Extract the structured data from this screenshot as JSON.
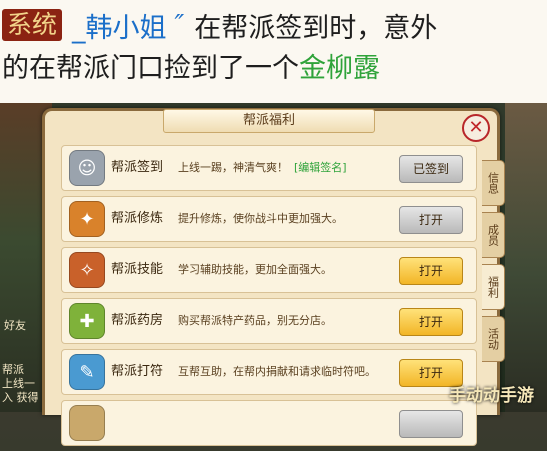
{
  "chat": {
    "tag": "系统",
    "sender": "_韩小姐",
    "bubble": "″",
    "message_part1": "在帮派签到时，意外",
    "message_part2": "的在帮派门口捡到了一个",
    "item": "金柳露"
  },
  "scene": {
    "left_text_1": "好友",
    "left_text_2": "帮派",
    "left_text_3": "上线一",
    "left_text_4": "入 获得"
  },
  "window": {
    "title": "帮派福利",
    "close_label": "✕"
  },
  "rows": [
    {
      "name": "帮派签到",
      "desc": "上线一踢，神清气爽！",
      "link": "[编辑签名]",
      "button": "已签到",
      "button_style": "gray",
      "icon": "sign-in-icon",
      "color": "#9aa3ad"
    },
    {
      "name": "帮派修炼",
      "desc": "提升修炼，使你战斗中更加强大。",
      "link": "",
      "button": "打开",
      "button_style": "gray",
      "icon": "cultivation-icon",
      "color": "#d9822b"
    },
    {
      "name": "帮派技能",
      "desc": "学习辅助技能，更加全面强大。",
      "link": "",
      "button": "打开",
      "button_style": "gold",
      "icon": "skill-icon",
      "color": "#c9612a"
    },
    {
      "name": "帮派药房",
      "desc": "购买帮派特产药品，别无分店。",
      "link": "",
      "button": "打开",
      "button_style": "gold",
      "icon": "pharmacy-icon",
      "color": "#7fb23a"
    },
    {
      "name": "帮派打符",
      "desc": "互帮互助，在帮内捐献和请求临时符吧。",
      "link": "",
      "button": "打开",
      "button_style": "gold",
      "icon": "talisman-icon",
      "color": "#4a9ad1"
    },
    {
      "name": "",
      "desc": "",
      "link": "",
      "button": "",
      "button_style": "gray",
      "icon": "extra-icon",
      "color": "#c9a86b"
    }
  ],
  "tabs": [
    {
      "label": "信息",
      "active": false
    },
    {
      "label": "成员",
      "active": false
    },
    {
      "label": "福利",
      "active": true
    },
    {
      "label": "活动",
      "active": false
    }
  ],
  "watermark": "手动动手游"
}
